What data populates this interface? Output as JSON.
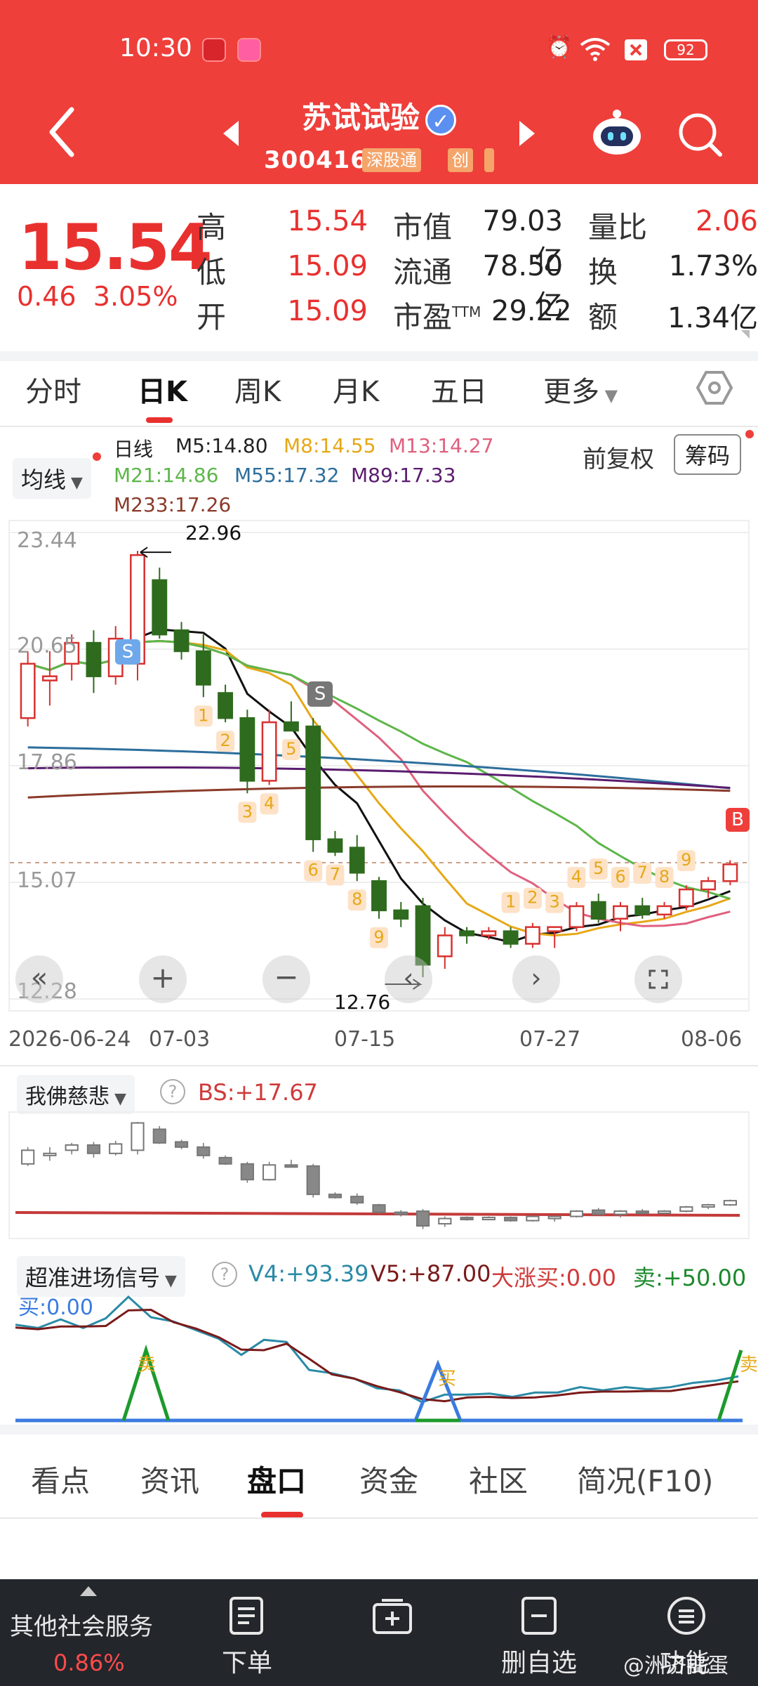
{
  "status_bar": {
    "time": "10:30",
    "battery": "92"
  },
  "header": {
    "stock_name": "苏试试验",
    "verified_mark": "✓",
    "stock_code": "300416",
    "tag_connect": "深股通",
    "tag_board": "创"
  },
  "quote": {
    "price": "15.54",
    "change": "0.46",
    "change_pct": "3.05%",
    "high_label": "高",
    "high": "15.54",
    "low_label": "低",
    "low": "15.09",
    "open_label": "开",
    "open": "15.09",
    "mcap_label": "市值",
    "mcap": "79.03亿",
    "float_label": "流通",
    "float": "78.50亿",
    "pe_label": "市盈",
    "pe_sup": "TTM",
    "pe": "29.22",
    "volratio_label": "量比",
    "volratio": "2.06",
    "turnover_label": "换",
    "turnover": "1.73%",
    "amount_label": "额",
    "amount": "1.34亿"
  },
  "tabs": [
    "分时",
    "日K",
    "周K",
    "月K",
    "五日",
    "更多"
  ],
  "chart_controls": {
    "ma_selector": "均线",
    "period_label": "日线",
    "adjust_label": "前复权",
    "chip_button": "筹码",
    "ma": [
      {
        "text": "M5:14.80",
        "color": "#111111"
      },
      {
        "text": "M8:14.55",
        "color": "#e6a817"
      },
      {
        "text": "M13:14.27",
        "color": "#e0607e"
      },
      {
        "text": "M21:14.86",
        "color": "#5db64a"
      },
      {
        "text": "M55:17.32",
        "color": "#2c6e9c"
      },
      {
        "text": "M89:17.33",
        "color": "#5b1c6f"
      },
      {
        "text": "M233:17.26",
        "color": "#8b3a2a"
      }
    ],
    "y_ticks": [
      "23.44",
      "20.65",
      "17.86",
      "15.07",
      "12.28"
    ],
    "high_mark": "22.96",
    "low_mark": "12.76",
    "x_ticks": [
      "2026-06-24",
      "07-03",
      "07-15",
      "07-27",
      "08-06"
    ],
    "signal_s1": "S",
    "signal_s2": "S",
    "signal_b": "B",
    "seq_counts": [
      "1",
      "2",
      "3",
      "4",
      "5",
      "6",
      "7",
      "8",
      "9"
    ]
  },
  "indicator1": {
    "selector": "我佛慈悲",
    "help": "?",
    "value": "BS:+17.67"
  },
  "indicator2": {
    "selector": "超准进场信号",
    "help": "?",
    "v4": "V4:+93.39",
    "v5": "V5:+87.00",
    "surge": "大涨买:0.00",
    "sell": "卖:+50.00",
    "buy": "买:0.00",
    "sell_marker": "卖",
    "buy_marker": "买"
  },
  "bottom_tabs": [
    "看点",
    "资讯",
    "盘口",
    "资金",
    "社区",
    "简况(F10)"
  ],
  "footer": {
    "other_service": "其他社会服务",
    "other_pct": "0.86%",
    "order": "下单",
    "delete_watch": "删自选",
    "function": "功能",
    "watermark": "@洲济捣蛋"
  },
  "chart_data": {
    "type": "candlestick",
    "x_axis": [
      "2026-06-24",
      "07-03",
      "07-15",
      "07-27",
      "08-06"
    ],
    "ylim": [
      12.28,
      23.44
    ],
    "y_ticks": [
      23.44,
      20.65,
      17.86,
      15.07,
      12.28
    ],
    "annotations": [
      {
        "label": "22.96",
        "type": "high"
      },
      {
        "label": "12.76",
        "type": "low"
      }
    ],
    "last_close": 15.54,
    "moving_averages": {
      "M5": 14.8,
      "M8": 14.55,
      "M13": 14.27,
      "M21": 14.86,
      "M55": 17.32,
      "M89": 17.33,
      "M233": 17.26
    },
    "candles": [
      {
        "o": 19.0,
        "h": 20.6,
        "l": 18.8,
        "c": 20.3
      },
      {
        "o": 19.9,
        "h": 20.6,
        "l": 19.3,
        "c": 20.0
      },
      {
        "o": 20.3,
        "h": 21.0,
        "l": 19.9,
        "c": 20.8
      },
      {
        "o": 20.8,
        "h": 21.1,
        "l": 19.6,
        "c": 20.0
      },
      {
        "o": 20.0,
        "h": 21.2,
        "l": 19.8,
        "c": 20.9
      },
      {
        "o": 20.3,
        "h": 23.0,
        "l": 19.9,
        "c": 22.9
      },
      {
        "o": 22.3,
        "h": 22.6,
        "l": 20.9,
        "c": 21.0
      },
      {
        "o": 21.1,
        "h": 21.3,
        "l": 20.4,
        "c": 20.6
      },
      {
        "o": 20.6,
        "h": 21.0,
        "l": 19.5,
        "c": 19.8
      },
      {
        "o": 19.6,
        "h": 19.8,
        "l": 18.9,
        "c": 19.0
      },
      {
        "o": 19.0,
        "h": 19.2,
        "l": 17.2,
        "c": 17.5
      },
      {
        "o": 17.5,
        "h": 19.2,
        "l": 17.4,
        "c": 18.9
      },
      {
        "o": 18.9,
        "h": 19.4,
        "l": 18.7,
        "c": 18.7
      },
      {
        "o": 18.8,
        "h": 19.0,
        "l": 15.8,
        "c": 16.1
      },
      {
        "o": 16.1,
        "h": 16.3,
        "l": 15.7,
        "c": 15.8
      },
      {
        "o": 15.9,
        "h": 16.2,
        "l": 15.1,
        "c": 15.3
      },
      {
        "o": 15.1,
        "h": 15.2,
        "l": 14.2,
        "c": 14.4
      },
      {
        "o": 14.4,
        "h": 14.6,
        "l": 14.0,
        "c": 14.2
      },
      {
        "o": 14.5,
        "h": 14.7,
        "l": 12.8,
        "c": 13.1
      },
      {
        "o": 13.3,
        "h": 14.0,
        "l": 13.0,
        "c": 13.8
      },
      {
        "o": 13.9,
        "h": 14.0,
        "l": 13.6,
        "c": 13.8
      },
      {
        "o": 13.8,
        "h": 14.0,
        "l": 13.7,
        "c": 13.9
      },
      {
        "o": 13.9,
        "h": 14.0,
        "l": 13.5,
        "c": 13.6
      },
      {
        "o": 13.6,
        "h": 14.1,
        "l": 13.5,
        "c": 14.0
      },
      {
        "o": 13.9,
        "h": 14.0,
        "l": 13.5,
        "c": 14.0
      },
      {
        "o": 14.0,
        "h": 14.6,
        "l": 13.9,
        "c": 14.5
      },
      {
        "o": 14.6,
        "h": 14.8,
        "l": 14.1,
        "c": 14.2
      },
      {
        "o": 14.2,
        "h": 14.6,
        "l": 13.9,
        "c": 14.5
      },
      {
        "o": 14.5,
        "h": 14.7,
        "l": 14.2,
        "c": 14.3
      },
      {
        "o": 14.3,
        "h": 14.6,
        "l": 14.2,
        "c": 14.5
      },
      {
        "o": 14.5,
        "h": 15.0,
        "l": 14.4,
        "c": 14.9
      },
      {
        "o": 14.9,
        "h": 15.2,
        "l": 14.7,
        "c": 15.1
      },
      {
        "o": 15.1,
        "h": 15.6,
        "l": 15.0,
        "c": 15.5
      }
    ]
  }
}
